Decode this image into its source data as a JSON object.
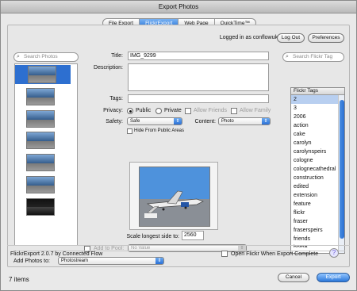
{
  "window": {
    "title": "Export Photos"
  },
  "tabs": [
    "File Export",
    "FlickrExport",
    "Web Page",
    "QuickTime™"
  ],
  "account": {
    "logged_in": "Logged in as conflowuk",
    "logout": "Log Out",
    "preferences": "Preferences"
  },
  "left": {
    "search_placeholder": "Search Photos"
  },
  "form": {
    "title_label": "Title:",
    "title_value": "IMG_9299",
    "description_label": "Description:",
    "tags_label": "Tags:",
    "privacy_label": "Privacy:",
    "public": "Public",
    "private": "Private",
    "friends": "Allow Friends",
    "family": "Allow Family",
    "safety_label": "Safety:",
    "safety_value": "Safe",
    "content_label": "Content:",
    "content_value": "Photo",
    "hide_public": "Hide From Public Areas",
    "scale_label": "Scale longest side to:",
    "scale_value": "2560",
    "pool_label": "Add to Pool:",
    "pool_value": "No Value"
  },
  "right": {
    "search_placeholder": "Search Flickr Tag",
    "header": "Flickr Tags",
    "tags": [
      "2",
      "3",
      "2006",
      "action",
      "cake",
      "carolyn",
      "carolynspeirs",
      "cologne",
      "colognecathedral",
      "construction",
      "edited",
      "extension",
      "feature",
      "flickr",
      "fraser",
      "fraserspeirs",
      "friends",
      "home"
    ]
  },
  "bottom": {
    "add_to_label": "Add Photos to:",
    "add_to_value": "Photostream",
    "version": "FlickrExport 2.0.7 by Connected Flow",
    "open_flickr": "Open Flickr When Export Complete",
    "count": "7 items",
    "cancel": "Cancel",
    "export": "Export",
    "help": "?"
  }
}
